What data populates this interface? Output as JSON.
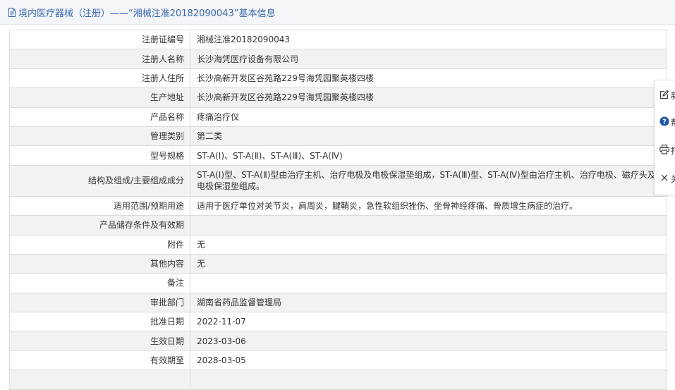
{
  "header": {
    "title": "境内医疗器械（注册）——“湘械注准20182090043”基本信息"
  },
  "table": [
    {
      "label": "注册证编号",
      "value": "湘械注准20182090043"
    },
    {
      "label": "注册人名称",
      "value": "长沙海凭医疗设备有限公司"
    },
    {
      "label": "注册人住所",
      "value": "长沙高新开发区谷苑路229号海凭园聚英楼四楼"
    },
    {
      "label": "生产地址",
      "value": "长沙高新开发区谷苑路229号海凭园聚英楼四楼"
    },
    {
      "label": "产品名称",
      "value": "疼痛治疗仪"
    },
    {
      "label": "管理类别",
      "value": "第二类"
    },
    {
      "label": "型号规格",
      "value": "ST-A(Ⅰ)、ST-A(Ⅱ)、ST-A(Ⅲ)、ST-A(Ⅳ)"
    },
    {
      "label": "结构及组成/主要组成成分",
      "value": "ST-A(Ⅰ)型、ST-A(Ⅱ)型由治疗主机、治疗电极及电极保湿垫组成，ST-A(Ⅲ)型、ST-A(Ⅳ)型由治疗主机、治疗电极、磁疗头及电极保湿垫组成。"
    },
    {
      "label": "适用范围/预期用途",
      "value": "适用于医疗单位对关节炎，肩周炎，腱鞘炎，急性软组织挫伤、坐骨神经疼痛、骨质增生病症的治疗。"
    },
    {
      "label": "产品储存条件及有效期",
      "value": ""
    },
    {
      "label": "附件",
      "value": "无"
    },
    {
      "label": "其他内容",
      "value": "无"
    },
    {
      "label": "备注",
      "value": ""
    },
    {
      "label": "审批部门",
      "value": "湖南省药品监督管理局"
    },
    {
      "label": "批准日期",
      "value": "2022-11-07"
    },
    {
      "label": "生效日期",
      "value": "2023-03-06"
    },
    {
      "label": "有效期至",
      "value": "2028-03-05"
    },
    {
      "label": "",
      "value": ""
    }
  ],
  "side_panel": {
    "items": [
      {
        "icon": "edit-icon",
        "label": "新"
      },
      {
        "icon": "help-icon",
        "label": "帮"
      },
      {
        "icon": "print-icon",
        "label": "打"
      },
      {
        "icon": "close-icon",
        "label": "关"
      }
    ]
  },
  "colors": {
    "title": "#3a66b0",
    "row_alt": "#f2f2f2",
    "border": "#dcdcdc",
    "help_icon": "#1e57a8"
  }
}
